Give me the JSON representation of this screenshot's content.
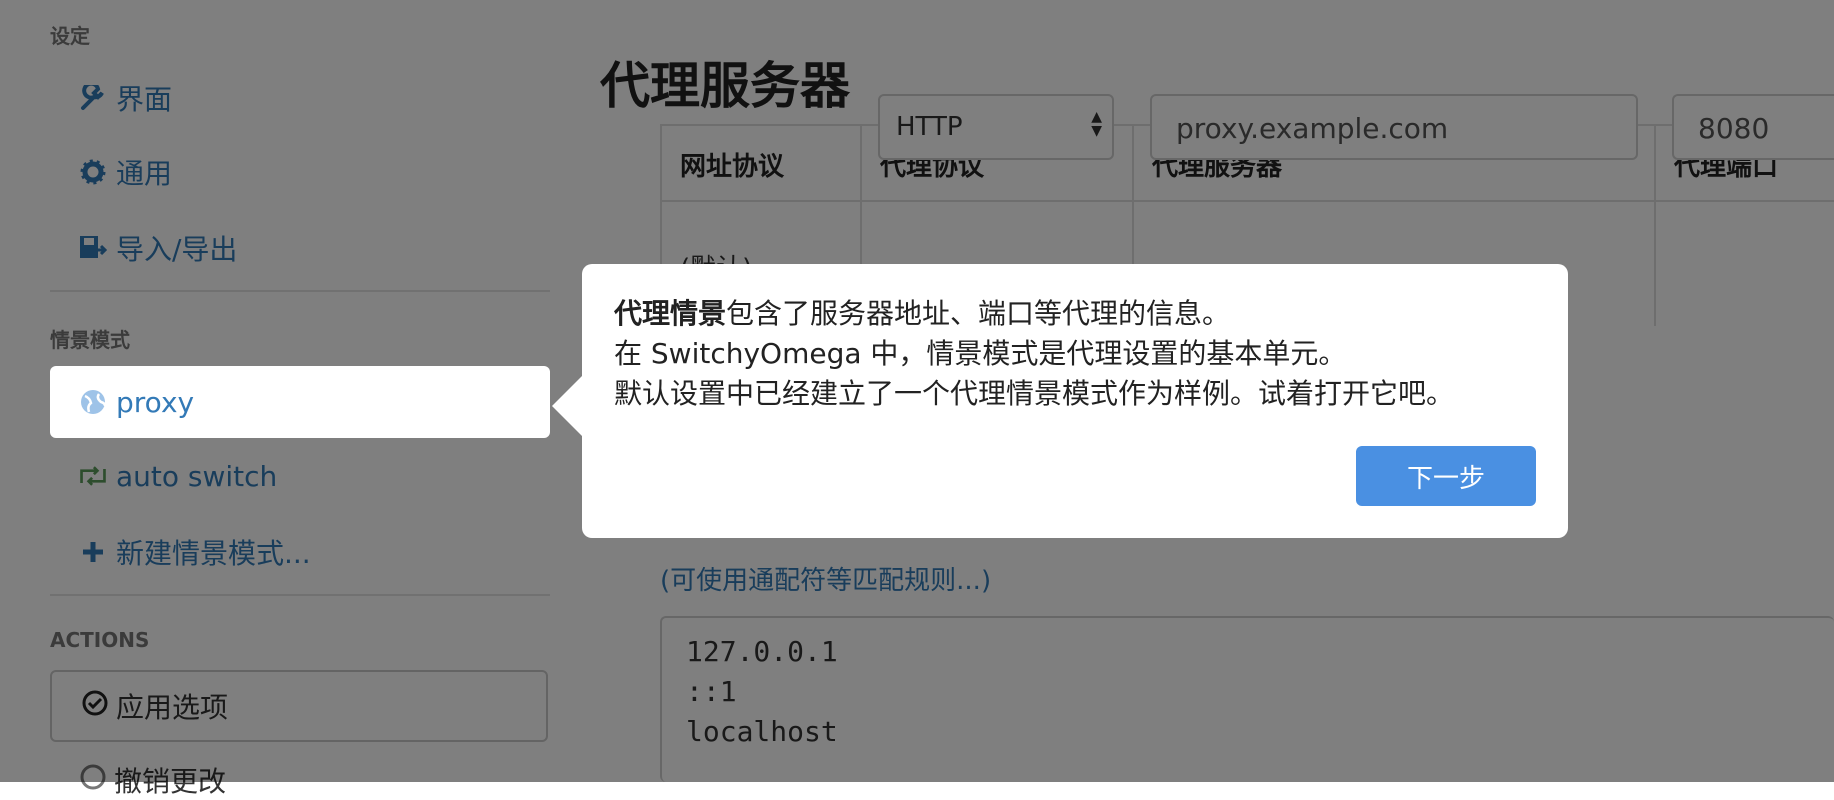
{
  "sidebar": {
    "settings_header": "设定",
    "settings_items": [
      {
        "label": "界面",
        "icon": "wrench-icon"
      },
      {
        "label": "通用",
        "icon": "gear-icon"
      },
      {
        "label": "导入/导出",
        "icon": "floppy-export-icon"
      }
    ],
    "profiles_header": "情景模式",
    "profiles": [
      {
        "label": "proxy",
        "icon": "globe-icon"
      },
      {
        "label": "auto switch",
        "icon": "retweet-icon"
      },
      {
        "label": "新建情景模式...",
        "icon": "plus-icon"
      }
    ],
    "actions_header": "ACTIONS",
    "actions": [
      {
        "label": "应用选项",
        "icon": "check-circle-icon"
      },
      {
        "label": "撤销更改",
        "icon": "undo-circle-icon"
      }
    ]
  },
  "main": {
    "title": "代理服务器",
    "table": {
      "headers": [
        "网址协议",
        "代理协议",
        "代理服务器",
        "代理端口"
      ],
      "row": {
        "scheme": "(默认)",
        "protocol": "HTTP",
        "server": "proxy.example.com",
        "port": "8080"
      }
    },
    "rules_link": "(可使用通配符等匹配规则...)",
    "bypass_list": "127.0.0.1\n::1\nlocalhost"
  },
  "popover": {
    "bold_term": "代理情景",
    "line1_rest": "包含了服务器地址、端口等代理的信息。",
    "line2": "在 SwitchyOmega 中，情景模式是代理设置的基本单元。",
    "line3": "默认设置中已经建立了一个代理情景模式作为样例。试着打开它吧。",
    "next_button": "下一步"
  },
  "colors": {
    "link": "#337ab7",
    "primary_button": "#4a90e2",
    "auto_switch_icon": "#5a9a5a",
    "overlay": "rgba(0,0,0,0.5)"
  }
}
